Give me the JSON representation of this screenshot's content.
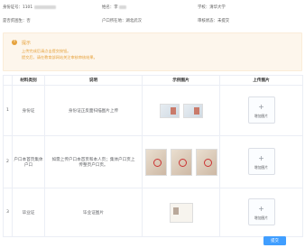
{
  "student": {
    "id_label": "身份证号：",
    "id_value": "1101",
    "name_label": "姓名：",
    "name_value": "李",
    "school_label": "学校：",
    "school_value": "清华大学",
    "poor_label": "是否贫困生：",
    "poor_value": "否",
    "hukou_label": "户口所在地：",
    "hukou_value": "湖北武汉",
    "status_label": "审核状态：",
    "status_value": "未提交"
  },
  "notice": {
    "icon": "!",
    "title": "提示",
    "lines": [
      "上传完成后请点击提交按钮。",
      "提交后，请在教育部网站关注审核审核结果。"
    ]
  },
  "table": {
    "headers": [
      "材料类别",
      "说明",
      "示例图片",
      "上传图片"
    ],
    "rows": [
      {
        "num": "1",
        "category": "身份证",
        "description": "身份证正反面扫描图片上传",
        "examples": [
          "idcard",
          "idcard"
        ],
        "upload_label": "增加图片"
      },
      {
        "num": "2",
        "category": "户口本首页集体户口",
        "description": "如需上传户口本首页和本人页；集体户口页上传整页户口页。",
        "examples": [
          "hukou",
          "hukou",
          "hukou"
        ],
        "upload_label": "增加图片"
      },
      {
        "num": "3",
        "category": "毕业证",
        "description": "毕业证图片",
        "examples": [
          "cert"
        ],
        "upload_label": "增加图片"
      }
    ]
  },
  "submit_label": "提交"
}
